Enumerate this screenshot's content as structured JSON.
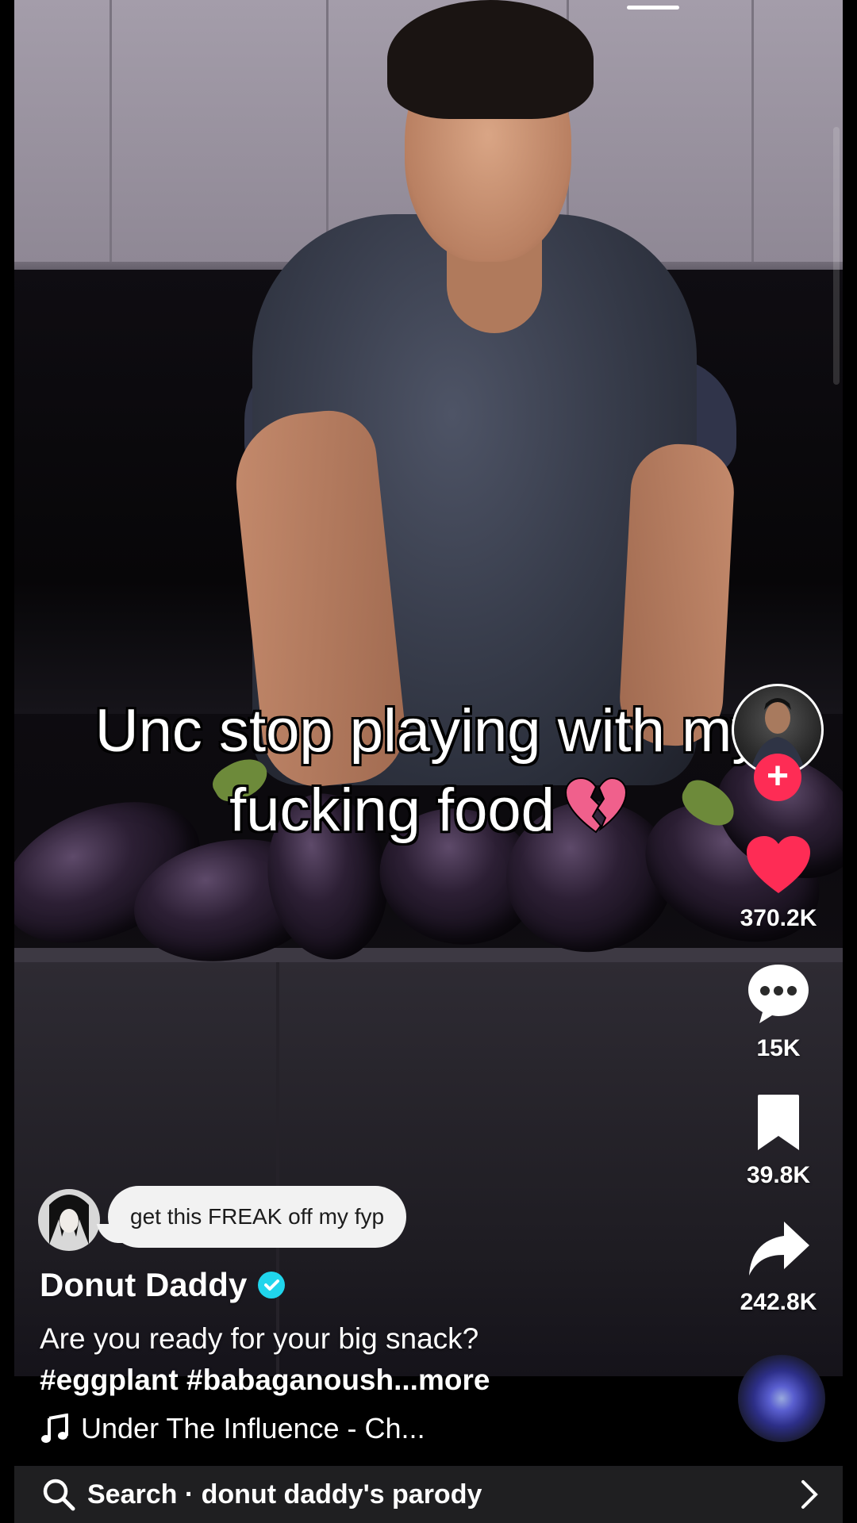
{
  "video": {
    "caption_line1": "Unc stop playing with my",
    "caption_line2": "fucking food",
    "caption_emoji": "broken-heart-emoji"
  },
  "actions": {
    "likes": "370.2K",
    "comments": "15K",
    "saves": "39.8K",
    "shares": "242.8K"
  },
  "comment_preview": {
    "text": "get this FREAK off my fyp"
  },
  "post": {
    "username": "Donut Daddy",
    "verified": true,
    "description": "Are you ready for your big snack?",
    "hashtags": "#eggplant #babaganoush",
    "more_label": "...more",
    "music": "Under The Influence - Ch..."
  },
  "search": {
    "label": "Search · donut daddy's parody"
  },
  "colors": {
    "like": "#fe2c55",
    "follow": "#fe2c55",
    "verified": "#20d5ec",
    "search_bg": "#1f1f21"
  },
  "icons": [
    "heart-icon",
    "comment-icon",
    "bookmark-icon",
    "share-icon",
    "music-note-icon",
    "search-icon",
    "chevron-right-icon",
    "verified-badge-icon",
    "plus-icon"
  ]
}
